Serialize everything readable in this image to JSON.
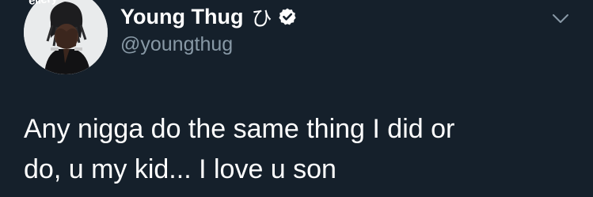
{
  "tweet": {
    "author": {
      "display_name": "Young Thug",
      "name_emoji": "ひ",
      "handle": "@youngthug",
      "avatar_overlay_text": "ellery"
    },
    "text": "Any nigga do the same thing I did or\ndo, u my kid... I love u son",
    "icons": {
      "verified": "verified-badge-icon",
      "more": "chevron-down-icon"
    },
    "colors": {
      "background": "#15202b",
      "text": "#ffffff",
      "secondary_text": "#8899a6"
    }
  }
}
